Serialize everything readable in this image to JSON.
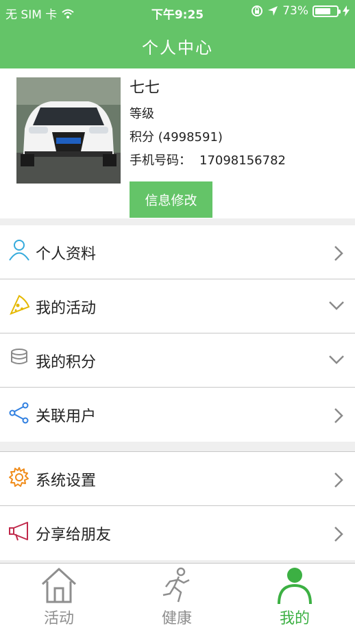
{
  "status": {
    "carrier": "无 SIM 卡",
    "time": "下午9:25",
    "battery": "73%",
    "battery_level": 0.73
  },
  "nav": {
    "title": "个人中心"
  },
  "profile": {
    "name": "七七",
    "level_label": "等级",
    "points_label": "积分 (4998591)",
    "phone_label": "手机号码：",
    "phone_value": "17098156782",
    "edit_button": "信息修改",
    "avatar_icon": "car-photo"
  },
  "menu_group_1": [
    {
      "label": "个人资料",
      "icon": "person-icon",
      "icon_color": "#34aadc",
      "arrow": "chevron-right"
    },
    {
      "label": "我的活动",
      "icon": "pizza-icon",
      "icon_color": "#e5b800",
      "arrow": "chevron-down"
    },
    {
      "label": "我的积分",
      "icon": "coins-icon",
      "icon_color": "#8a8a8a",
      "arrow": "chevron-down"
    },
    {
      "label": "关联用户",
      "icon": "share-icon",
      "icon_color": "#2f7fe0",
      "arrow": "chevron-right"
    }
  ],
  "menu_group_2": [
    {
      "label": "系统设置",
      "icon": "gear-icon",
      "icon_color": "#f08c1a",
      "arrow": "chevron-right"
    },
    {
      "label": "分享给朋友",
      "icon": "megaphone-icon",
      "icon_color": "#c0284a",
      "arrow": "chevron-right"
    }
  ],
  "tabbar": [
    {
      "label": "活动",
      "icon": "house-icon",
      "active": false
    },
    {
      "label": "健康",
      "icon": "runner-icon",
      "active": false
    },
    {
      "label": "我的",
      "icon": "person-filled-icon",
      "active": true
    }
  ],
  "colors": {
    "brand": "#64c468",
    "active_tab": "#3cb043",
    "inactive_tab": "#8e8e8e"
  }
}
